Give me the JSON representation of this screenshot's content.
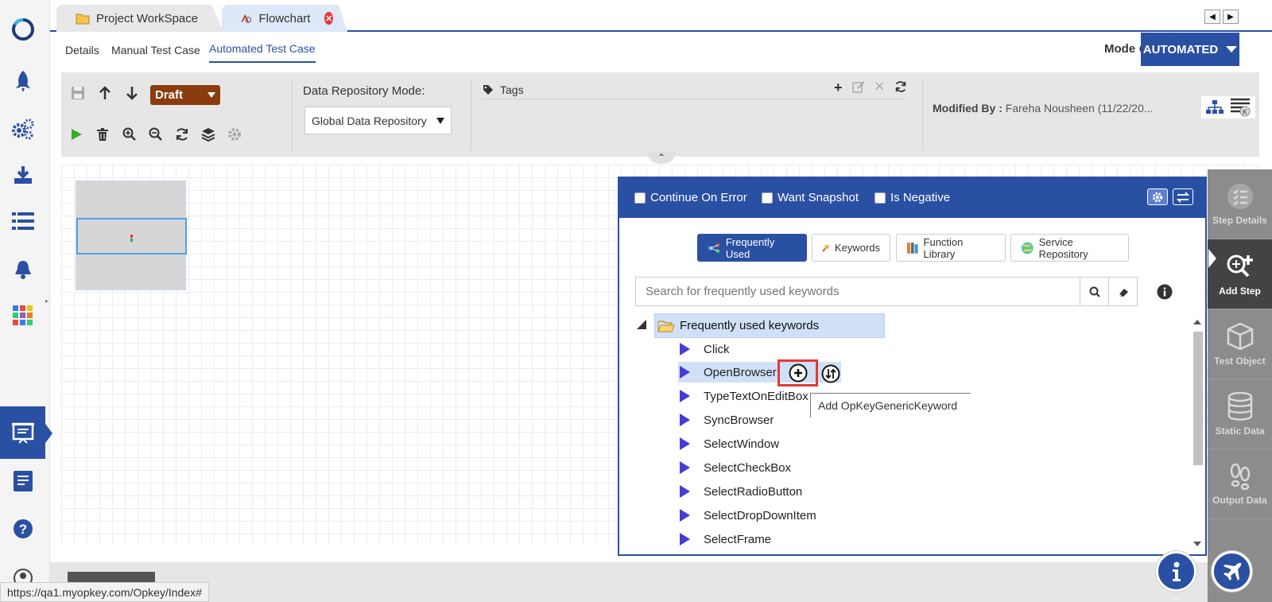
{
  "tabs": [
    {
      "label": "Project WorkSpace",
      "icon": "folder-icon"
    },
    {
      "label": "Flowchart",
      "icon": "flowchart-icon"
    }
  ],
  "subtabs": [
    "Details",
    "Manual Test Case",
    "Automated Test Case"
  ],
  "mode": {
    "label": "Mode",
    "value": "AUTOMATED"
  },
  "toolbar": {
    "status": "Draft",
    "data_repository_label": "Data Repository Mode:",
    "data_repository_value": "Global Data Repository",
    "tags_label": "Tags",
    "modified_by_label": "Modified By :",
    "modified_by_value": "Fareha Nousheen (11/22/20..."
  },
  "panel": {
    "options": [
      "Continue On Error",
      "Want Snapshot",
      "Is Negative"
    ],
    "keyword_tabs": [
      "Frequently Used",
      "Keywords",
      "Function Library",
      "Service Repository"
    ],
    "search_placeholder": "Search for frequently used keywords",
    "tree_root": "Frequently used keywords",
    "items": [
      "Click",
      "OpenBrowser",
      "TypeTextOnEditBox",
      "SyncBrowser",
      "SelectWindow",
      "SelectCheckBox",
      "SelectRadioButton",
      "SelectDropDownItem",
      "SelectFrame"
    ],
    "tooltip": "Add OpKeyGenericKeyword"
  },
  "rightbar": [
    "Step Details",
    "Add Step",
    "Test Object",
    "Static Data",
    "Output Data"
  ],
  "status_url": "https://qa1.myopkey.com/Opkey/Index#",
  "colors": {
    "primary": "#2a50a3",
    "draft": "#8b3c0e",
    "highlight": "#cfe0f7",
    "add_border": "#e53935"
  }
}
